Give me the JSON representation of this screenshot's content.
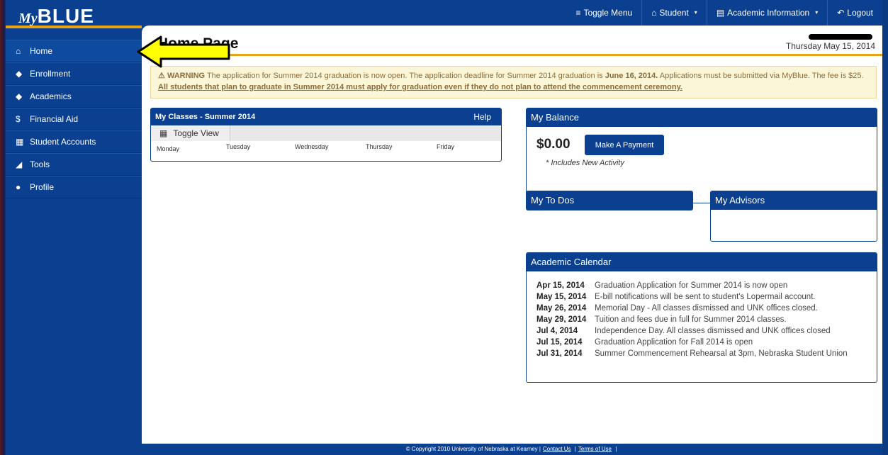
{
  "brand": {
    "prefix": "My",
    "name": "BLUE"
  },
  "topnav": [
    {
      "icon": "≡",
      "label": "Toggle Menu",
      "caret": ""
    },
    {
      "icon": "⌂",
      "label": "Student",
      "caret": "▾"
    },
    {
      "icon": "▤",
      "label": "Academic Information",
      "caret": "▾"
    },
    {
      "icon": "↶",
      "label": "Logout",
      "caret": ""
    }
  ],
  "sidebar": {
    "items": [
      {
        "icon": "⌂",
        "label": "Home"
      },
      {
        "icon": "◆",
        "label": "Enrollment"
      },
      {
        "icon": "◆",
        "label": "Academics"
      },
      {
        "icon": "$",
        "label": "Financial Aid"
      },
      {
        "icon": "▦",
        "label": "Student Accounts"
      },
      {
        "icon": "◢",
        "label": "Tools"
      },
      {
        "icon": "●",
        "label": "Profile"
      }
    ]
  },
  "page": {
    "title": "Home Page",
    "date": "Thursday May 15, 2014"
  },
  "warning": {
    "icon": "⚠",
    "label": "WARNING",
    "text1": " The application for Summer 2014 graduation is now open. The application deadline for Summer 2014 graduation is ",
    "deadline": "June 16, 2014.",
    "text2": " Applications must be submitted via MyBlue. The fee is $25.  ",
    "underlined": "All students that plan to graduate in Summer 2014 must apply for graduation even if they do not plan to attend the commencement ceremony."
  },
  "classes": {
    "title": "My Classes - Summer 2014",
    "help": "Help",
    "toggle_label": "Toggle View",
    "days": [
      "Monday",
      "Tuesday",
      "Wednesday",
      "Thursday",
      "Friday"
    ]
  },
  "balance": {
    "title": "My Balance",
    "amount": "$0.00",
    "pay_button": "Make A Payment",
    "note": "* Includes New Activity"
  },
  "todos": {
    "title": "My To Dos"
  },
  "advisors": {
    "title": "My Advisors"
  },
  "calendar": {
    "title": "Academic Calendar",
    "events": [
      {
        "date": "Apr 15, 2014",
        "text": "Graduation Application for Summer 2014 is now open"
      },
      {
        "date": "May 15, 2014",
        "text": "E-bill notifications will be sent to student's Lopermail account."
      },
      {
        "date": "May 26, 2014",
        "text": "Memorial Day - All classes dismissed and UNK offices closed."
      },
      {
        "date": "May 29, 2014",
        "text": "Tuition and fees due in full for Summer 2014 classes."
      },
      {
        "date": "Jul 4, 2014",
        "text": "Independence Day. All classes dismissed and UNK offices closed"
      },
      {
        "date": "Jul 15, 2014",
        "text": "Graduation Application for Fall 2014 is open"
      },
      {
        "date": "Jul 31, 2014",
        "text": "Summer Commencement Rehearsal at 3pm, Nebraska Student Union"
      }
    ]
  },
  "footer": {
    "copyright": "© Copyright 2010 University of Nebraska at Kearney",
    "contact": "Contact Us",
    "terms": "Terms of Use",
    "sep": "|"
  },
  "colors": {
    "brand_blue": "#0b3f8f",
    "accent_gold": "#e8a317",
    "arrow_yellow": "#ffff00"
  }
}
